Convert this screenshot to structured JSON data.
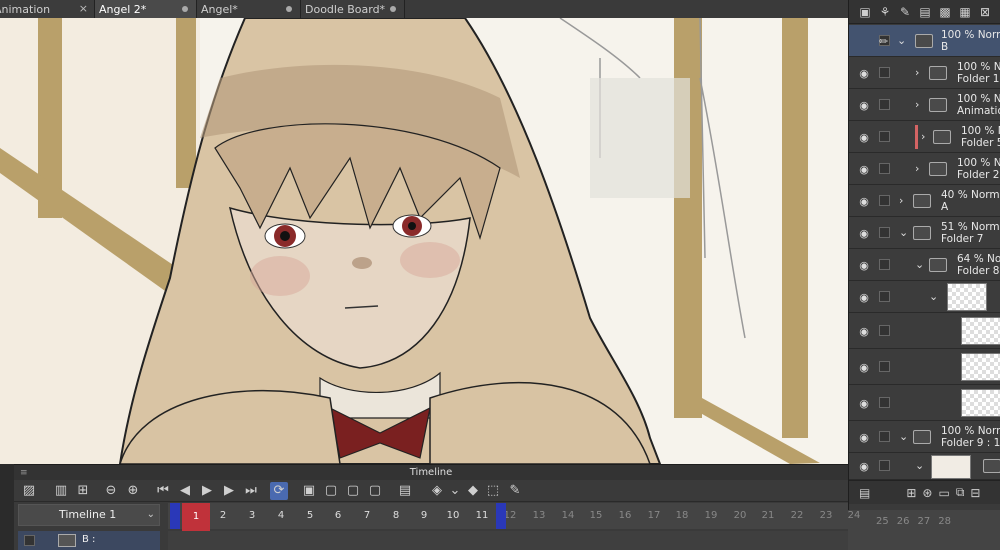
{
  "tabs": [
    {
      "label": "Animation",
      "close": "×"
    },
    {
      "label": "Angel 2*",
      "close": "●"
    },
    {
      "label": "Angel*",
      "close": "●"
    },
    {
      "label": "Doodle Board*",
      "close": "●"
    }
  ],
  "layers": [
    {
      "title": "100 % Norm",
      "sub": "B",
      "selected": true
    },
    {
      "title": "100 % No",
      "sub": "Folder 1"
    },
    {
      "title": "100 % No",
      "sub": "Animation"
    },
    {
      "title": "100 % No",
      "sub": "Folder 5"
    },
    {
      "title": "100 % No",
      "sub": "Folder 2"
    },
    {
      "title": "40 % Norma",
      "sub": "A"
    },
    {
      "title": "51 % Norma",
      "sub": "Folder 7"
    },
    {
      "title": "64 % Norm",
      "sub": "Folder 8"
    },
    {
      "title": "100 % Norm",
      "sub": "Folder 9 : 1"
    }
  ],
  "timeline": {
    "title": "Timeline",
    "select_label": "Timeline 1",
    "track_label": "B :",
    "current_frame": "1",
    "frames": [
      "1",
      "2",
      "3",
      "4",
      "5",
      "6",
      "7",
      "8",
      "9",
      "10",
      "11",
      "12",
      "13",
      "14",
      "15",
      "16",
      "17",
      "18",
      "19",
      "20",
      "21",
      "22",
      "23",
      "24"
    ],
    "frames_right": [
      "25",
      "26",
      "27",
      "28"
    ]
  },
  "colors": {
    "playhead": "#c0323a",
    "marker": "#2a38b8",
    "selected_layer": "#43536f"
  }
}
